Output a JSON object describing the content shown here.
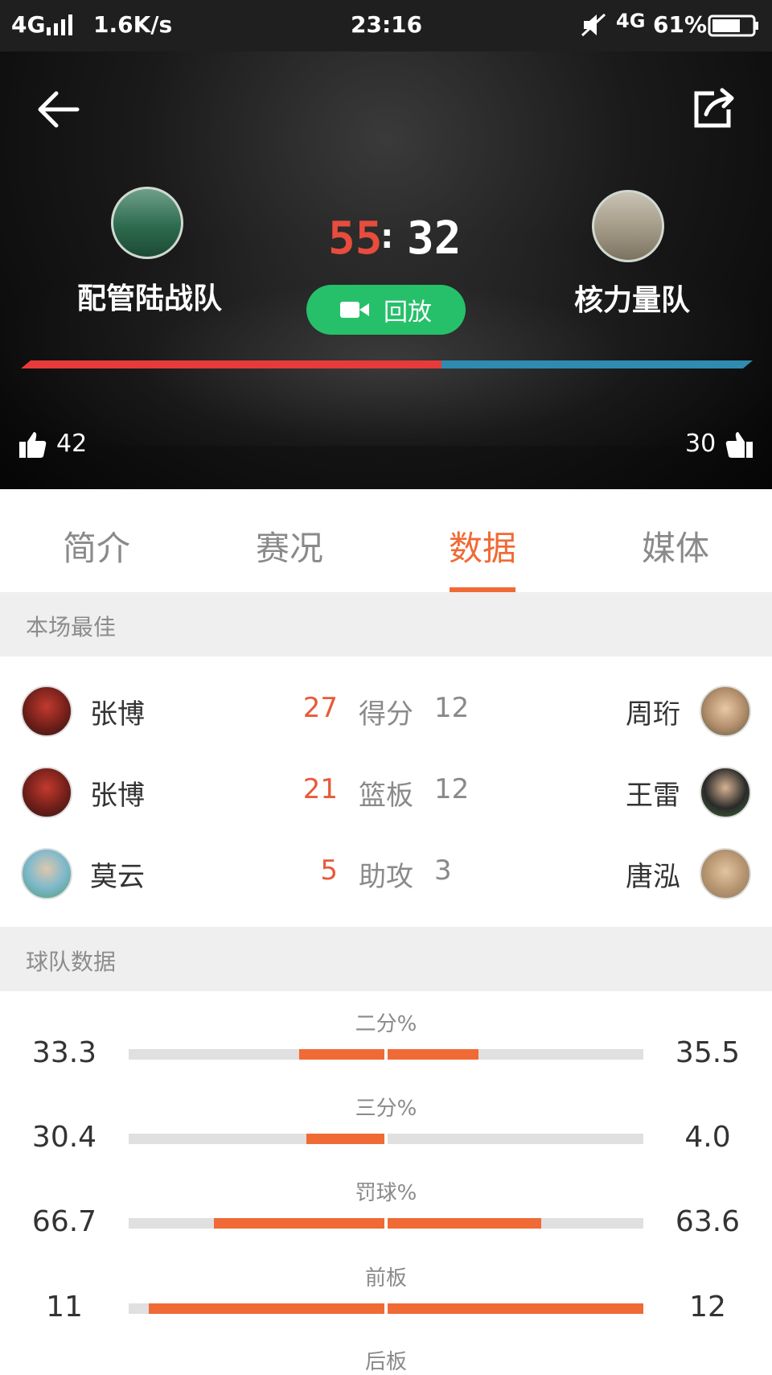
{
  "status_bar": {
    "network": "4G",
    "speed": "1.6K/s",
    "time": "23:16",
    "network_right": "4G",
    "battery": "61%"
  },
  "header": {
    "home": {
      "name": "配管陆战队",
      "score": "55"
    },
    "away": {
      "name": "核力量队",
      "score": "32"
    },
    "separator": ":",
    "replay_label": "回放",
    "home_likes": "42",
    "away_likes": "30",
    "progress_home_fraction": 0.575,
    "colors": {
      "home": "#e83a3a",
      "away": "#2f8bb0",
      "replay": "#26c06a"
    }
  },
  "tabs": {
    "items": [
      "简介",
      "赛况",
      "数据",
      "媒体"
    ],
    "active_index": 2,
    "accent": "#f06a35"
  },
  "best": {
    "section_title": "本场最佳",
    "rows": [
      {
        "home_player": "张博",
        "home_value": "27",
        "label": "得分",
        "away_value": "12",
        "away_player": "周珩"
      },
      {
        "home_player": "张博",
        "home_value": "21",
        "label": "篮板",
        "away_value": "12",
        "away_player": "王雷"
      },
      {
        "home_player": "莫云",
        "home_value": "5",
        "label": "助攻",
        "away_value": "3",
        "away_player": "唐泓"
      }
    ]
  },
  "team_stats": {
    "section_title": "球队数据",
    "rows": [
      {
        "label": "二分%",
        "home": "33.3",
        "away": "35.5",
        "home_frac": 0.333,
        "away_frac": 0.355
      },
      {
        "label": "三分%",
        "home": "30.4",
        "away": "4.0",
        "home_frac": 0.304,
        "away_frac": 0.0
      },
      {
        "label": "罚球%",
        "home": "66.7",
        "away": "63.6",
        "home_frac": 0.667,
        "away_frac": 0.6
      },
      {
        "label": "前板",
        "home": "11",
        "away": "12",
        "home_frac": 0.92,
        "away_frac": 1.0
      }
    ],
    "next_label": "后板"
  }
}
